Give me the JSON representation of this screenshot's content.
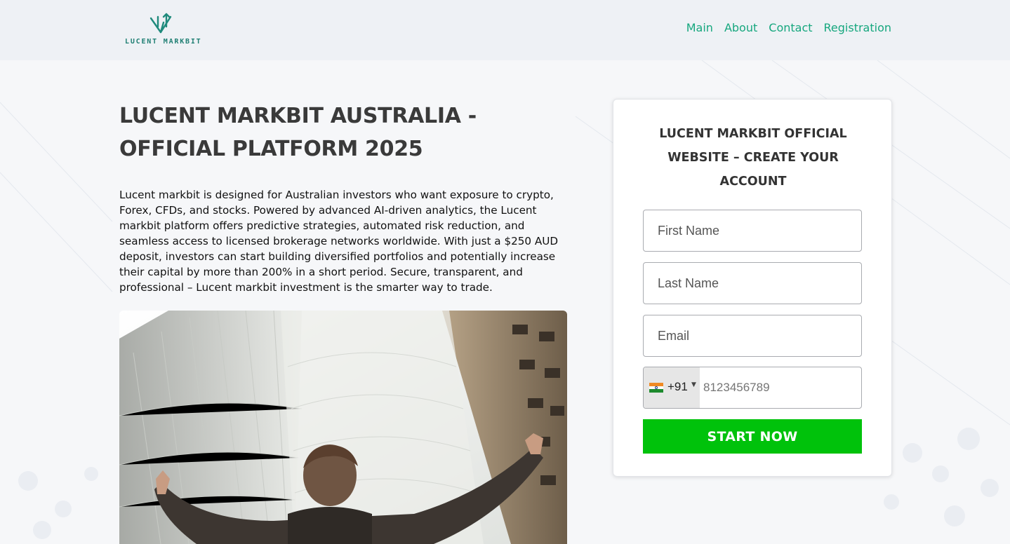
{
  "header": {
    "logo_text": "LUCENT MARKBIT",
    "nav": [
      {
        "label": "Main"
      },
      {
        "label": "About"
      },
      {
        "label": "Contact"
      },
      {
        "label": "Registration"
      }
    ]
  },
  "hero": {
    "title": "LUCENT MARKBIT AUSTRALIA - OFFICIAL PLATFORM 2025",
    "description": "Lucent markbit is designed for Australian investors who want exposure to crypto, Forex, CFDs, and stocks. Powered by advanced AI-driven analytics, the Lucent markbit platform offers predictive strategies, automated risk reduction, and seamless access to licensed brokerage networks worldwide. With just a $250 AUD deposit, investors can start building diversified portfolios and potentially increase their capital by more than 200% in a short period. Secure, transparent, and professional – Lucent markbit investment is the smarter way to trade."
  },
  "form": {
    "title": "LUCENT MARKBIT OFFICIAL WEBSITE – CREATE YOUR ACCOUNT",
    "first_name_placeholder": "First Name",
    "last_name_placeholder": "Last Name",
    "email_placeholder": "Email",
    "phone": {
      "country_code": "+91",
      "country_flag": "india-flag",
      "placeholder": "8123456789"
    },
    "submit_label": "START NOW"
  },
  "colors": {
    "accent": "#16a77e",
    "button": "#00c20b",
    "header_bg": "#eef1f5"
  }
}
